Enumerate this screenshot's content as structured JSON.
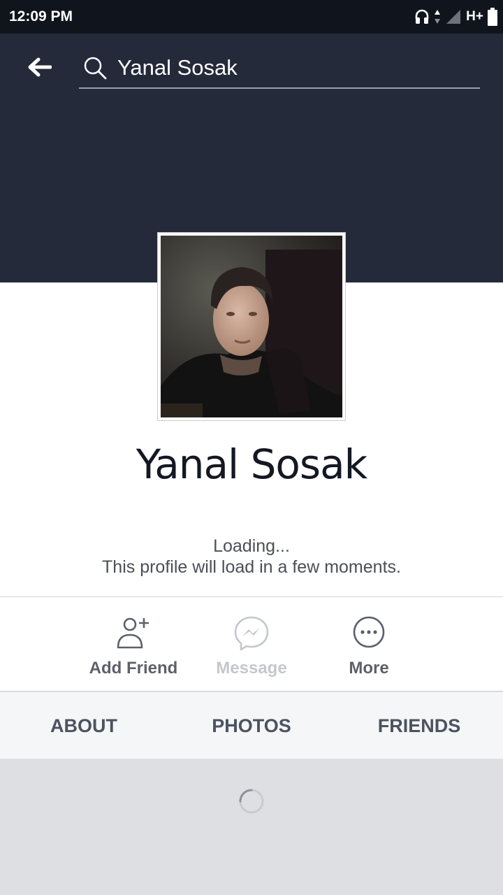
{
  "status_bar": {
    "time": "12:09 PM",
    "network": "H+",
    "icons": [
      "headphones-icon",
      "data-arrows-icon",
      "signal-icon",
      "battery-icon"
    ]
  },
  "header": {
    "back_icon": "arrow-left-icon",
    "search_icon": "search-icon",
    "search_value": "Yanal Sosak",
    "background_color": "#242a3a"
  },
  "profile": {
    "name": "Yanal Sosak",
    "loading_line1": "Loading...",
    "loading_line2": "This profile will load in a few moments."
  },
  "actions": [
    {
      "label": "Add Friend",
      "icon": "add-friend-icon",
      "enabled": true
    },
    {
      "label": "Message",
      "icon": "messenger-icon",
      "enabled": false
    },
    {
      "label": "More",
      "icon": "more-icon",
      "enabled": true
    }
  ],
  "tabs": [
    {
      "label": "ABOUT"
    },
    {
      "label": "PHOTOS"
    },
    {
      "label": "FRIENDS"
    }
  ],
  "colors": {
    "status_bar": "#10141d",
    "header": "#242a3a",
    "action_text": "#5d6069",
    "action_disabled": "#c4c7cc",
    "tab_bar": "#f5f6f7",
    "feed_bg": "#dddfe3"
  }
}
